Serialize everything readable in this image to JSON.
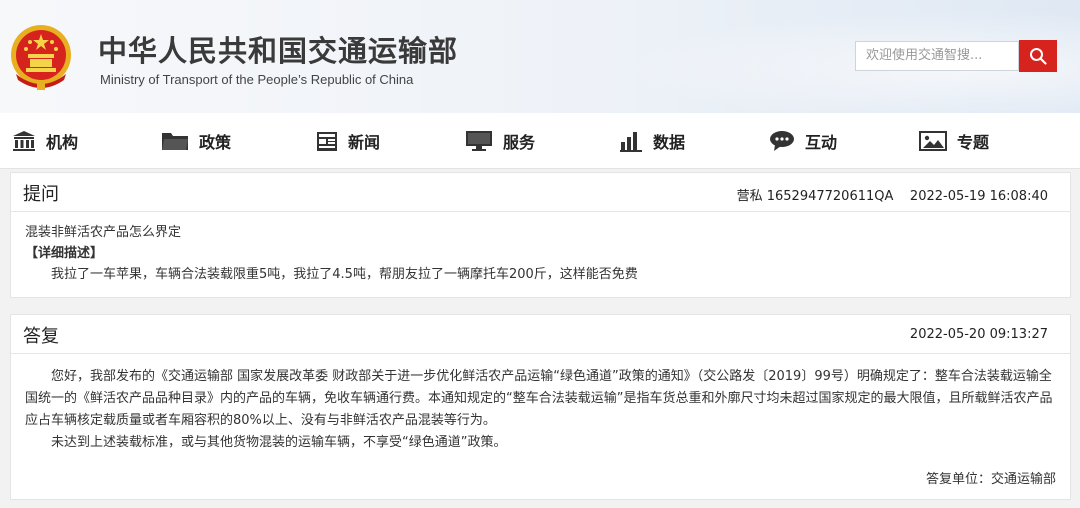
{
  "header": {
    "title_cn": "中华人民共和国交通运输部",
    "title_en": "Ministry of Transport of the People’s Republic of China",
    "search_placeholder": "欢迎使用交通智搜..."
  },
  "nav": {
    "items": [
      {
        "label": "机构",
        "icon": "building-icon"
      },
      {
        "label": "政策",
        "icon": "folder-icon"
      },
      {
        "label": "新闻",
        "icon": "newspaper-icon"
      },
      {
        "label": "服务",
        "icon": "monitor-icon"
      },
      {
        "label": "数据",
        "icon": "bar-chart-icon"
      },
      {
        "label": "互动",
        "icon": "chat-bubble-icon"
      },
      {
        "label": "专题",
        "icon": "picture-icon"
      }
    ]
  },
  "question": {
    "heading": "提问",
    "author": "营私 1652947720611QA",
    "time": "2022-05-19 16:08:40",
    "subject": "混装非鲜活农产品怎么界定",
    "detail_label": "【详细描述】",
    "detail": "我拉了一车苹果，车辆合法装载限重5吨，我拉了4.5吨，帮朋友拉了一辆摩托车200斤，这样能否免费"
  },
  "answer": {
    "heading": "答复",
    "time": "2022-05-20 09:13:27",
    "para1": "您好，我部发布的《交通运输部 国家发展改革委 财政部关于进一步优化鲜活农产品运输“绿色通道”政策的通知》（交公路发〔2019〕99号）明确规定了：整车合法装载运输全国统一的《鲜活农产品品种目录》内的产品的车辆，免收车辆通行费。本通知规定的“整车合法装载运输”是指车货总重和外廓尺寸均未超过国家规定的最大限值，且所载鲜活农产品应占车辆核定载质量或者车厢容积的80%以上、没有与非鲜活农产品混装等行为。",
    "para2": "未达到上述装载标准，或与其他货物混装的运输车辆，不享受“绿色通道”政策。",
    "signature": "答复单位：交通运输部"
  },
  "colors": {
    "accent_red": "#d7231e",
    "emblem_gold": "#e8b021"
  }
}
